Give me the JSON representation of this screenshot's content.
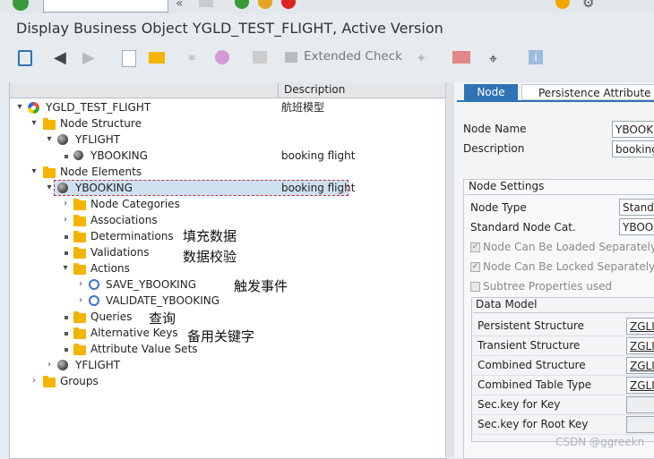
{
  "window": {
    "title": "Display Business Object YGLD_TEST_FLIGHT, Active Version"
  },
  "toolbar": {
    "extended_check_label": "Extended Check"
  },
  "tree": {
    "header_description": "Description",
    "root": {
      "label": "YGLD_TEST_FLIGHT",
      "description": "航班模型"
    },
    "node_structure": {
      "label": "Node Structure"
    },
    "ns_yflight": {
      "label": "YFLIGHT"
    },
    "ns_ybooking": {
      "label": "YBOOKING",
      "description": "booking flight"
    },
    "node_elements": {
      "label": "Node Elements"
    },
    "ne_ybooking": {
      "label": "YBOOKING",
      "description": "booking flight"
    },
    "node_categories": {
      "label": "Node Categories"
    },
    "associations": {
      "label": "Associations"
    },
    "determinations": {
      "label": "Determinations"
    },
    "validations": {
      "label": "Validations"
    },
    "actions": {
      "label": "Actions"
    },
    "save_ybooking": {
      "label": "SAVE_YBOOKING"
    },
    "validate_ybooking": {
      "label": "VALIDATE_YBOOKING"
    },
    "queries": {
      "label": "Queries"
    },
    "alternative_keys": {
      "label": "Alternative Keys"
    },
    "attribute_value_sets": {
      "label": "Attribute Value Sets"
    },
    "ne_yflight": {
      "label": "YFLIGHT"
    },
    "groups": {
      "label": "Groups"
    }
  },
  "annotations": {
    "determinations": "填充数据",
    "validations": "数据校验",
    "actions": "触发事件",
    "queries": "查询",
    "alternative_keys": "备用关键字"
  },
  "detail": {
    "tabs": [
      "Node",
      "Persistence Attribute M"
    ],
    "node_name_label": "Node Name",
    "node_name_value": "YBOOKI",
    "description_label": "Description",
    "description_value": "booking",
    "node_settings": {
      "title": "Node Settings",
      "node_type_label": "Node Type",
      "node_type_value": "Standa",
      "standard_cat_label": "Standard Node Cat.",
      "standard_cat_value": "YBOO",
      "can_be_loaded": "Node Can Be Loaded Separately",
      "can_be_locked": "Node Can Be Locked Separately",
      "subtree_props": "Subtree Properties used"
    },
    "data_model": {
      "title": "Data Model",
      "rows": [
        {
          "label": "Persistent Structure",
          "value": "ZGLI"
        },
        {
          "label": "Transient Structure",
          "value": "ZGLI"
        },
        {
          "label": "Combined Structure",
          "value": "ZGLI"
        },
        {
          "label": "Combined Table Type",
          "value": "ZGLI"
        },
        {
          "label": "Sec.key for Key",
          "value": ""
        },
        {
          "label": "Sec.key for Root Key",
          "value": ""
        }
      ]
    }
  },
  "watermark": "CSDN @ggreekn"
}
